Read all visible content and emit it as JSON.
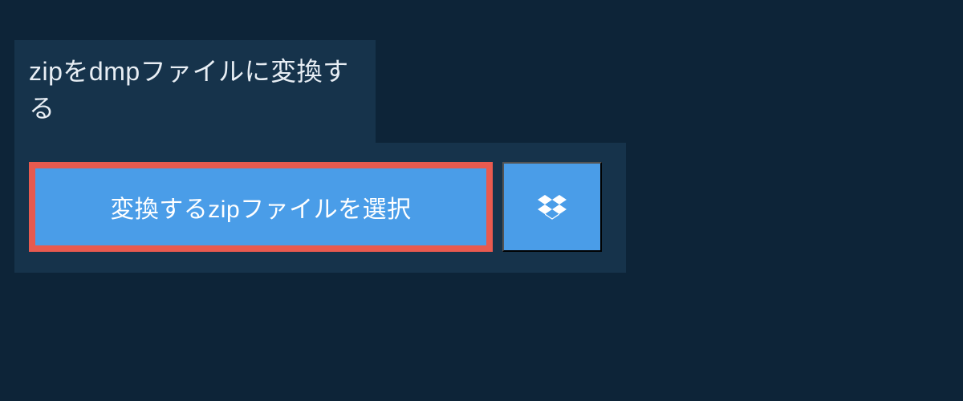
{
  "header": {
    "title": "zipをdmpファイルに変換する"
  },
  "actions": {
    "select_file_label": "変換するzipファイルを選択"
  }
}
